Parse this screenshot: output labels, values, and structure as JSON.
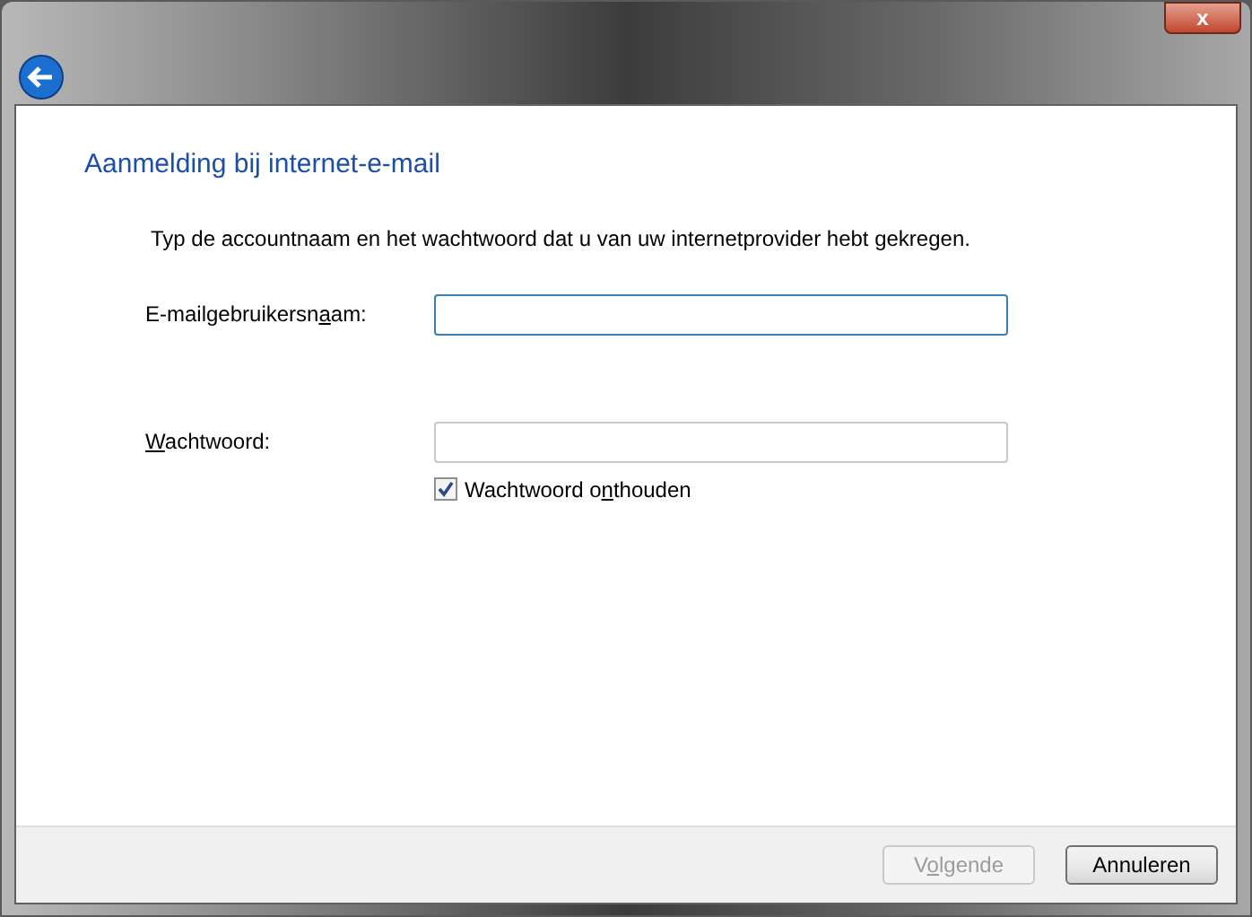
{
  "window": {
    "close": "x"
  },
  "heading": "Aanmelding bij internet-e-mail",
  "instruction": "Typ de accountnaam en het wachtwoord dat u van uw internetprovider hebt gekregen.",
  "fields": [
    {
      "label": {
        "before": "E-mailgebruikersn",
        "key": "a",
        "after": "am:"
      },
      "focused": true
    },
    {
      "label": {
        "key": "W",
        "after": "achtwoord:"
      },
      "focused": false
    }
  ],
  "remember": {
    "label": {
      "before": "Wachtwoord o",
      "key": "n",
      "after": "thouden"
    },
    "checked": true
  },
  "buttons": [
    {
      "label": {
        "before": "V",
        "key": "o",
        "after": "lgende"
      },
      "disabled": true
    },
    {
      "label": {
        "before": "Annuleren"
      },
      "disabled": false
    }
  ]
}
